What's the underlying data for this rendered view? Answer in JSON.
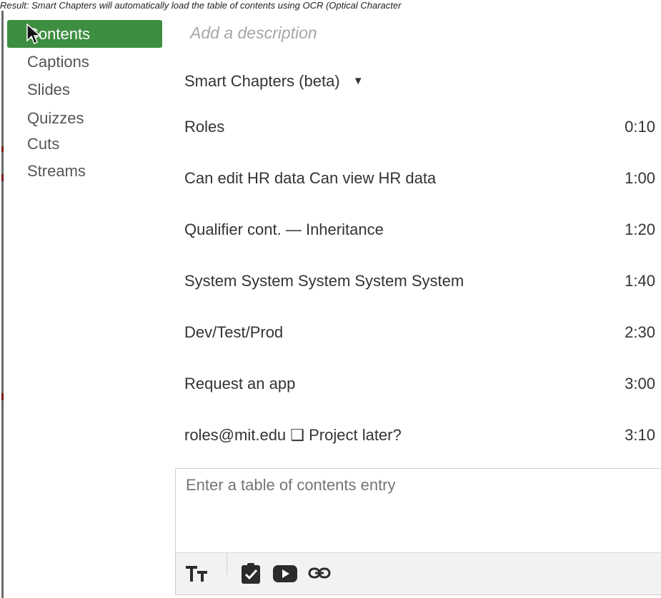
{
  "caption": {
    "lead": "Result:",
    "text": "Smart Chapters will automatically load the table of contents using OCR (Optical Character"
  },
  "sidebar": {
    "items": [
      {
        "label": "Contents",
        "active": true
      },
      {
        "label": "Captions"
      },
      {
        "label": "Slides"
      },
      {
        "label": "Quizzes"
      },
      {
        "label": "Cuts"
      },
      {
        "label": "Streams"
      }
    ]
  },
  "main": {
    "description_placeholder": "Add a description",
    "smart_chapters": {
      "label": "Smart Chapters (beta)",
      "caret": "▼"
    },
    "chapters": [
      {
        "title": "Roles",
        "time": "0:10"
      },
      {
        "title": "Can edit HR data Can view HR data",
        "time": "1:00"
      },
      {
        "title": "Qualifier cont. — Inheritance",
        "time": "1:20"
      },
      {
        "title": "System System System System System",
        "time": "1:40"
      },
      {
        "title": "Dev/Test/Prod",
        "time": "2:30"
      },
      {
        "title": "Request an app",
        "time": "3:00"
      },
      {
        "title": "roles@mit.edu ❑ Project later?",
        "time": "3:10"
      }
    ],
    "entry": {
      "placeholder": "Enter a table of contents entry",
      "toolbar": [
        "text-size-icon",
        "quiz-check-icon",
        "youtube-icon",
        "link-icon"
      ]
    }
  },
  "colors": {
    "active_nav_bg": "#3e8e41",
    "text": "#333333",
    "muted": "#a6a6a6"
  }
}
